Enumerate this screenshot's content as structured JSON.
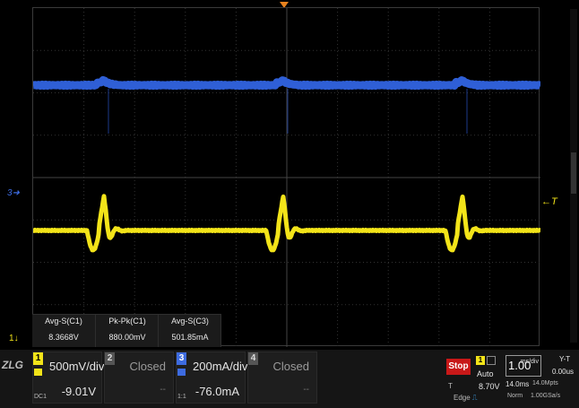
{
  "measurements": [
    {
      "label": "Avg-S(C1)",
      "value": "8.3668V"
    },
    {
      "label": "Pk-Pk(C1)",
      "value": "880.00mV"
    },
    {
      "label": "Avg-S(C3)",
      "value": "501.85mA"
    }
  ],
  "markers": {
    "ch3": "3",
    "ch1": "1",
    "trigger_level": "T"
  },
  "channels": [
    {
      "number": "1",
      "scale": "500mV/div",
      "offset": "-9.01V",
      "state": "on",
      "coupling": "DC1",
      "color": "#f3e419"
    },
    {
      "number": "2",
      "state_label": "Closed",
      "dots": "--",
      "color": "#888888"
    },
    {
      "number": "3",
      "scale": "200mA/div",
      "offset": "-76.0mA",
      "coupling": "1:1",
      "color": "#3d6be0"
    },
    {
      "number": "4",
      "state_label": "Closed",
      "dots": "--",
      "color": "#888888"
    }
  ],
  "acquisition": {
    "run_state": "Stop",
    "trigger_mode": "Auto",
    "trigger_label": "T",
    "trigger_value": "8.70V",
    "trigger_type": "Edge",
    "trigger_source": "1",
    "timebase": "1.00",
    "timebase_unit": "ms/div",
    "delay": "14.0ms",
    "sample_rate_1": "14.0Mpts",
    "mode": "Norm",
    "sample_rate_2": "1.00GSa/s",
    "display_mode": "Y-T",
    "position": "0.00us"
  },
  "logo": "ZLG",
  "colors": {
    "ch1": "#f3e419",
    "ch3": "#2f5fd6",
    "trigger_pos": "#e8821e"
  }
}
